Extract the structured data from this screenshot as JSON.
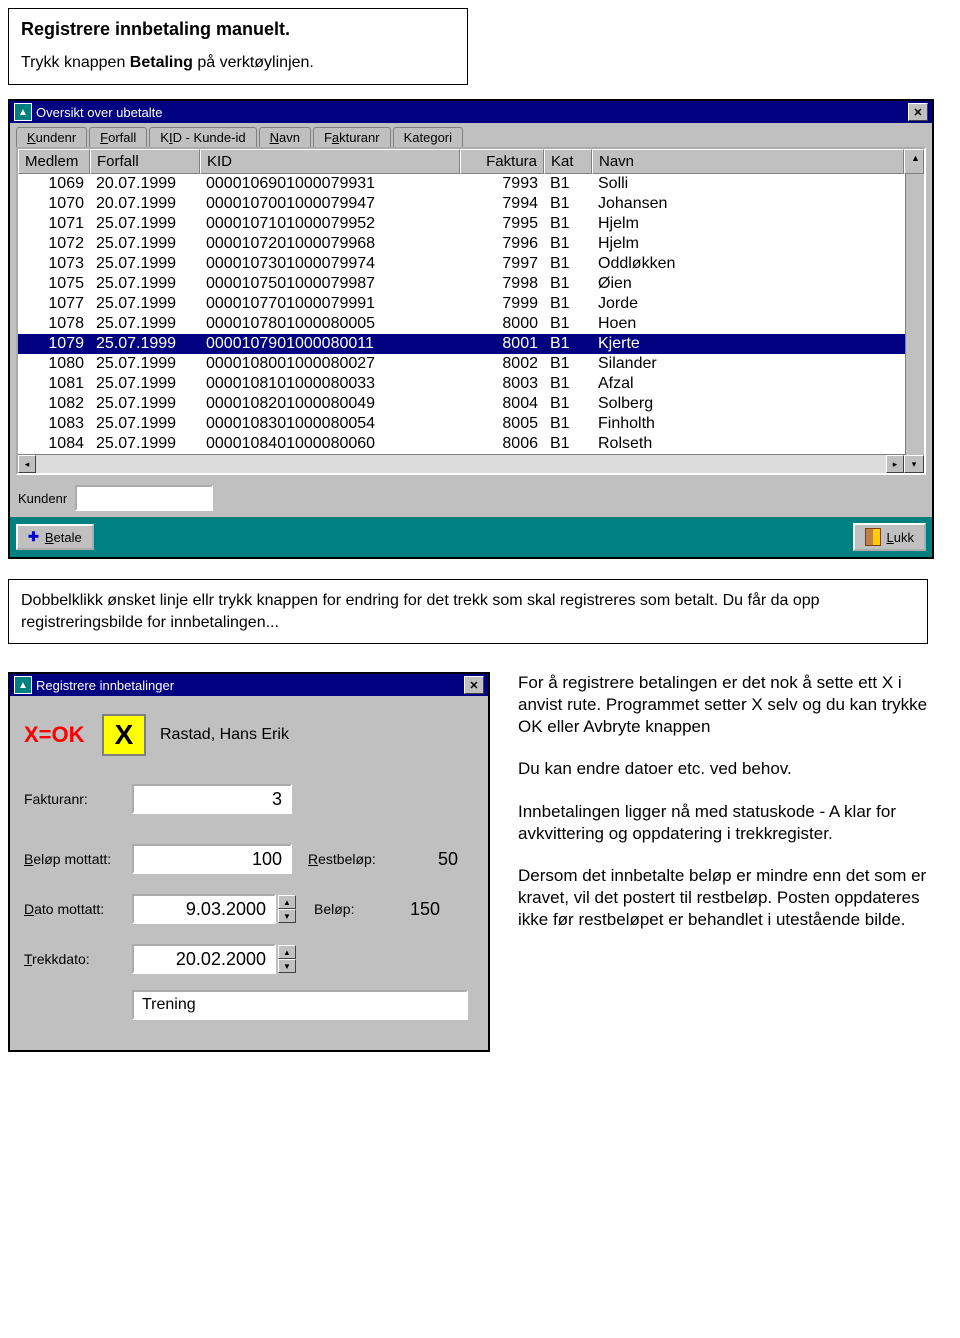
{
  "box1": {
    "title": "Registrere innbetaling manuelt.",
    "line_pre": "Trykk knappen ",
    "line_bold": "Betaling",
    "line_post": " på verktøylinjen."
  },
  "win1": {
    "title": "Oversikt over ubetalte",
    "tabs": [
      {
        "pre": "",
        "ul": "K",
        "post": "undenr"
      },
      {
        "pre": "",
        "ul": "F",
        "post": "orfall"
      },
      {
        "pre": "K",
        "ul": "I",
        "post": "D - Kunde-id"
      },
      {
        "pre": "",
        "ul": "N",
        "post": "avn"
      },
      {
        "pre": "F",
        "ul": "a",
        "post": "kturanr"
      },
      {
        "pre": "Kate",
        "ul": "g",
        "post": "ori"
      }
    ],
    "headers": {
      "medlem": "Medlem",
      "forfall": "Forfall",
      "kid": "KID",
      "faktura": "Faktura",
      "kat": "Kat",
      "navn": "Navn"
    },
    "rows": [
      {
        "medlem": "1069",
        "forfall": "20.07.1999",
        "kid": "0000106901000079931",
        "faktura": "7993",
        "kat": "B1",
        "navn": "Solli",
        "sel": false
      },
      {
        "medlem": "1070",
        "forfall": "20.07.1999",
        "kid": "0000107001000079947",
        "faktura": "7994",
        "kat": "B1",
        "navn": "Johansen",
        "sel": false
      },
      {
        "medlem": "1071",
        "forfall": "25.07.1999",
        "kid": "0000107101000079952",
        "faktura": "7995",
        "kat": "B1",
        "navn": "Hjelm",
        "sel": false
      },
      {
        "medlem": "1072",
        "forfall": "25.07.1999",
        "kid": "0000107201000079968",
        "faktura": "7996",
        "kat": "B1",
        "navn": "Hjelm",
        "sel": false
      },
      {
        "medlem": "1073",
        "forfall": "25.07.1999",
        "kid": "0000107301000079974",
        "faktura": "7997",
        "kat": "B1",
        "navn": "Oddløkken",
        "sel": false
      },
      {
        "medlem": "1075",
        "forfall": "25.07.1999",
        "kid": "0000107501000079987",
        "faktura": "7998",
        "kat": "B1",
        "navn": "Øien",
        "sel": false
      },
      {
        "medlem": "1077",
        "forfall": "25.07.1999",
        "kid": "0000107701000079991",
        "faktura": "7999",
        "kat": "B1",
        "navn": "Jorde",
        "sel": false
      },
      {
        "medlem": "1078",
        "forfall": "25.07.1999",
        "kid": "0000107801000080005",
        "faktura": "8000",
        "kat": "B1",
        "navn": "Hoen",
        "sel": false
      },
      {
        "medlem": "1079",
        "forfall": "25.07.1999",
        "kid": "0000107901000080011",
        "faktura": "8001",
        "kat": "B1",
        "navn": "Kjerte",
        "sel": true
      },
      {
        "medlem": "1080",
        "forfall": "25.07.1999",
        "kid": "0000108001000080027",
        "faktura": "8002",
        "kat": "B1",
        "navn": "Silander",
        "sel": false
      },
      {
        "medlem": "1081",
        "forfall": "25.07.1999",
        "kid": "0000108101000080033",
        "faktura": "8003",
        "kat": "B1",
        "navn": "Afzal",
        "sel": false
      },
      {
        "medlem": "1082",
        "forfall": "25.07.1999",
        "kid": "0000108201000080049",
        "faktura": "8004",
        "kat": "B1",
        "navn": "Solberg",
        "sel": false
      },
      {
        "medlem": "1083",
        "forfall": "25.07.1999",
        "kid": "0000108301000080054",
        "faktura": "8005",
        "kat": "B1",
        "navn": "Finholth",
        "sel": false
      },
      {
        "medlem": "1084",
        "forfall": "25.07.1999",
        "kid": "0000108401000080060",
        "faktura": "8006",
        "kat": "B1",
        "navn": "Rolseth",
        "sel": false
      }
    ],
    "footer_label": "Kundenr",
    "betale_label": "Betale",
    "lukk_label": "Lukk"
  },
  "box2": {
    "text": "Dobbelklikk ønsket linje ellr trykk knappen for endring for det trekk som skal registreres som betalt. Du får da opp registreringsbilde for innbetalingen..."
  },
  "win2": {
    "title": "Registrere innbetalinger",
    "xok": "X=OK",
    "xmark": "X",
    "name": "Rastad, Hans Erik",
    "fakturanr_label": "Fakturanr:",
    "fakturanr_value": "3",
    "belop_mottatt_label_pre": "",
    "belop_mottatt_ul": "B",
    "belop_mottatt_label_post": "eløp mottatt:",
    "belop_mottatt_value": "100",
    "restbelop_label_pre": "",
    "restbelop_ul": "R",
    "restbelop_label_post": "estbeløp:",
    "restbelop_value": "50",
    "dato_mottatt_label_pre": "",
    "dato_mottatt_ul": "D",
    "dato_mottatt_label_post": "ato mottatt:",
    "dato_mottatt_value": "9.03.2000",
    "belop_label": "Beløp:",
    "belop_value": "150",
    "trekkdato_label_pre": "",
    "trekkdato_ul": "T",
    "trekkdato_label_post": "rekkdato:",
    "trekkdato_value": "20.02.2000",
    "dropdown_value": "Trening"
  },
  "side": {
    "p1": "For å registrere betalingen er det nok å sette ett X i anvist rute. Programmet setter X selv og du kan trykke OK eller Avbryte knappen",
    "p2": "Du kan endre datoer etc. ved behov.",
    "p3": "Innbetalingen ligger nå med statuskode - A klar for avkvittering og oppdatering i trekkregister.",
    "p4": "Dersom det innbetalte beløp er mindre enn det som er kravet, vil det postert til restbeløp. Posten oppdateres ikke før restbeløpet er behandlet i utestående bilde."
  }
}
